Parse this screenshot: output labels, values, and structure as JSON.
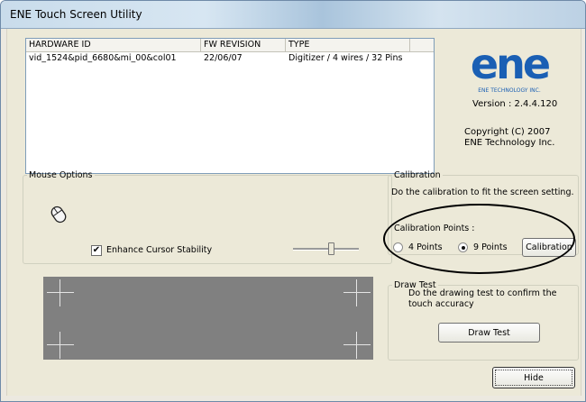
{
  "window": {
    "title": "ENE Touch Screen Utility"
  },
  "hardware_list": {
    "columns": [
      "HARDWARE ID",
      "FW REVISION",
      "TYPE"
    ],
    "rows": [
      {
        "hardware_id": "vid_1524&pid_6680&mi_00&col01",
        "fw_revision": "22/06/07",
        "type": "Digitizer / 4 wires / 32 Pins"
      }
    ]
  },
  "about": {
    "logo_text": "ene",
    "logo_caption": "ENE TECHNOLOGY INC.",
    "version": "Version :  2.4.4.120",
    "copyright_line1": "Copyright (C) 2007",
    "copyright_line2": "ENE Technology Inc.",
    "brand_color": "#1a5fb4"
  },
  "mouse_options": {
    "legend": "Mouse Options",
    "enhance_cursor_label": "Enhance Cursor Stability",
    "enhance_cursor_checked": true,
    "slider_value": 0.55
  },
  "calibration": {
    "legend": "Calibration",
    "description": "Do the calibration to fit the screen setting.",
    "points_label": "Calibration Points :",
    "option_4": "4 Points",
    "option_9": "9 Points",
    "selected": "9 Points",
    "button": "Calibration"
  },
  "draw_test": {
    "legend": "Draw Test",
    "description_line1": "Do the drawing test to confirm the",
    "description_line2": "touch accuracy",
    "button": "Draw Test"
  },
  "footer": {
    "hide_button": "Hide"
  }
}
